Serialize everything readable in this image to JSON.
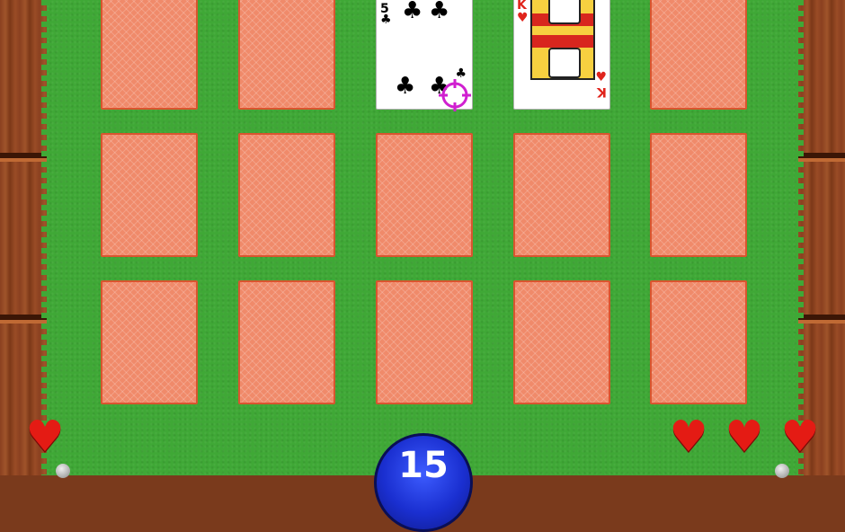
{
  "game": {
    "name": "",
    "score_value": "15",
    "lives": 1,
    "opponent_lives": 3
  },
  "board": {
    "rows": 3,
    "cols": 5,
    "revealed": [
      {
        "row": 0,
        "col": 2,
        "rank": "5",
        "suit": "clubs",
        "suit_glyph": "♣",
        "color": "#000000"
      },
      {
        "row": 0,
        "col": 3,
        "rank": "K",
        "suit": "hearts",
        "suit_glyph": "♥",
        "color": "#e0241c"
      }
    ]
  },
  "colors": {
    "felt": "#3fa836",
    "card_back": "#f08a6a",
    "card_back_border": "#d9552f",
    "heart": "#e41b14",
    "orb": "#1a2fd0",
    "cursor": "#d020d0"
  }
}
